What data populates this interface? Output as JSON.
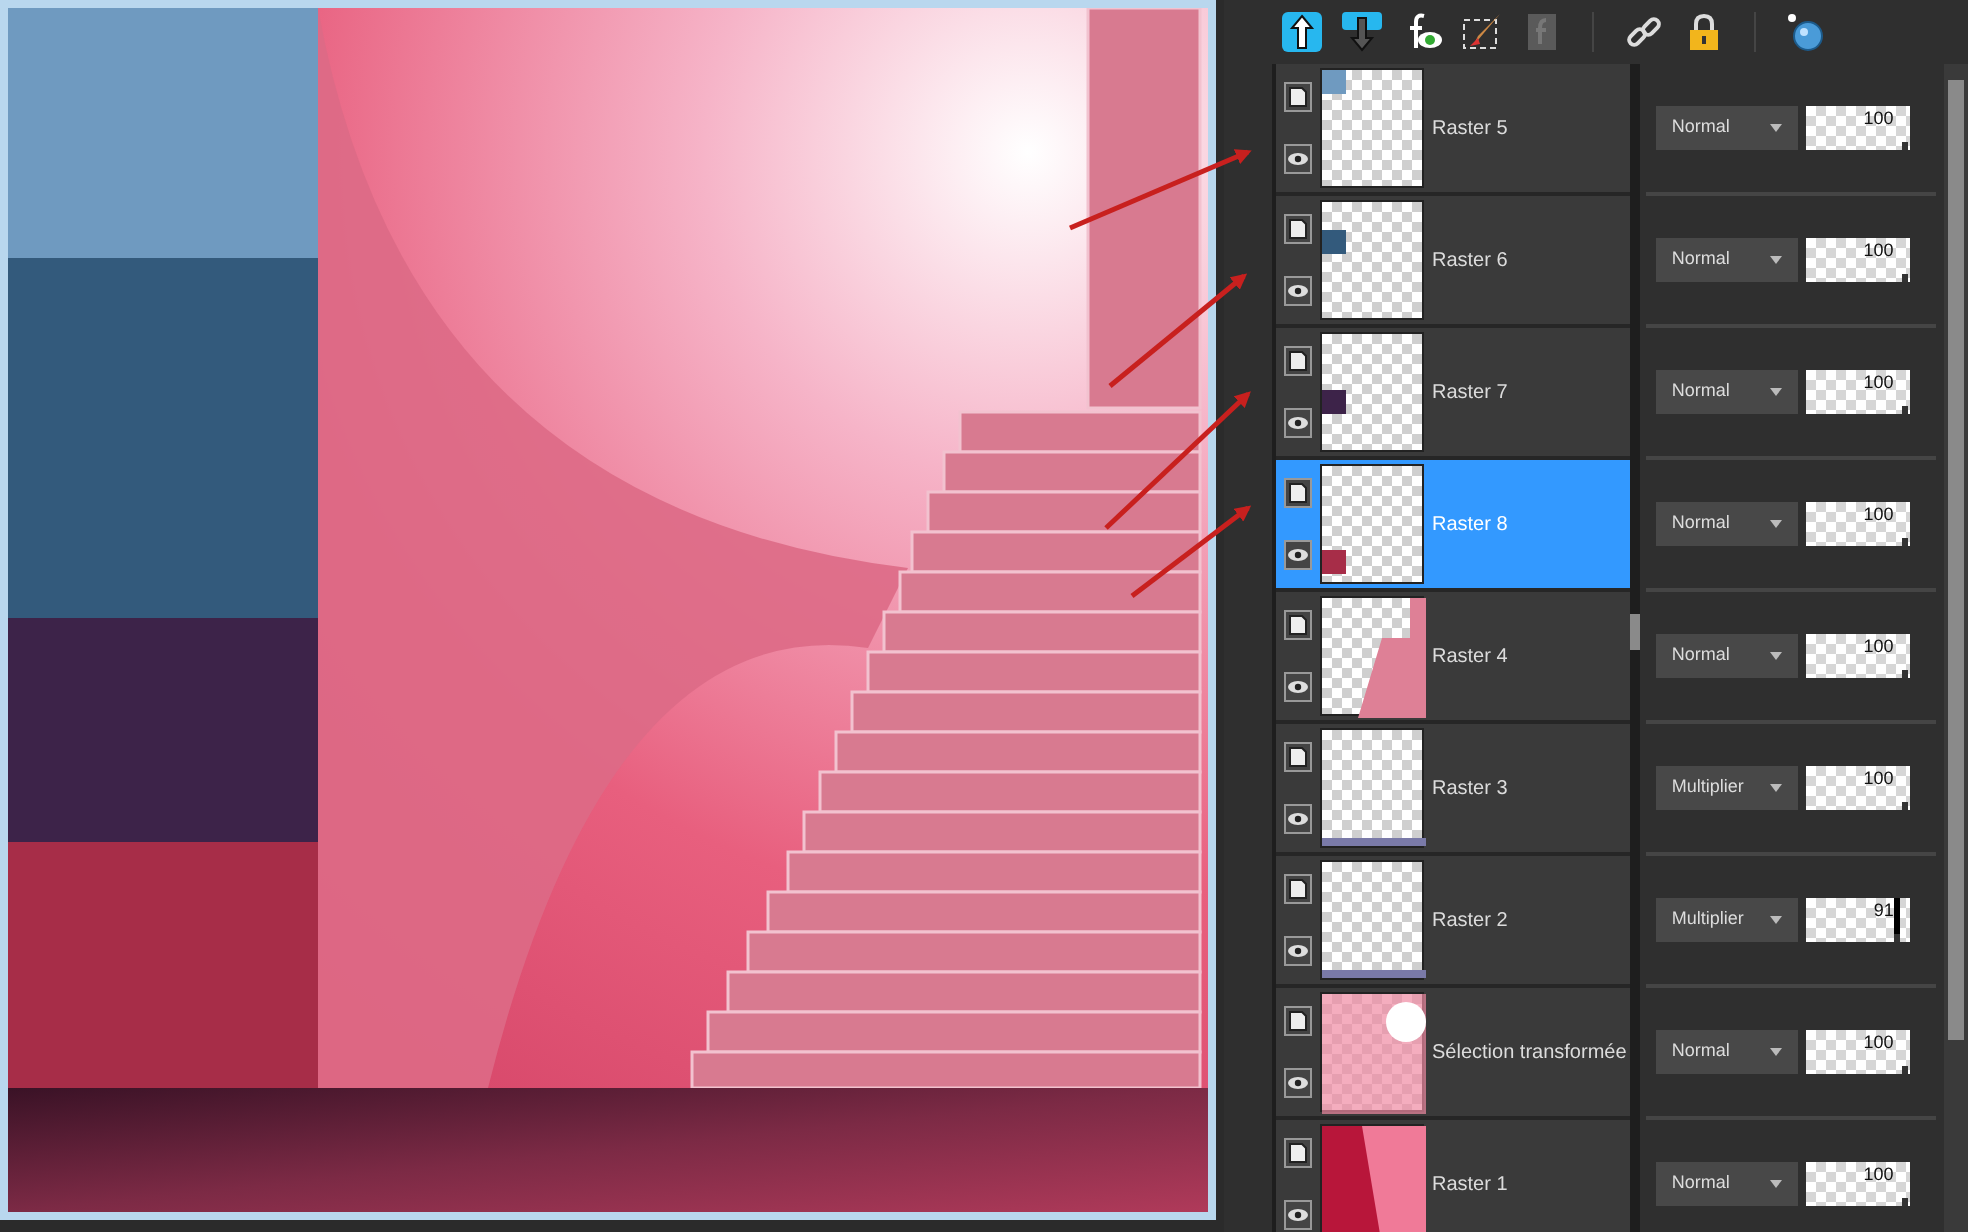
{
  "layers": [
    {
      "name": "Raster 5",
      "selected": false,
      "visible": true,
      "kind": "swatch",
      "color": "#6f9ac0",
      "blend": "Normal",
      "opacity": "100",
      "level": 1
    },
    {
      "name": "Raster 6",
      "selected": false,
      "visible": true,
      "kind": "swatch",
      "color": "#335a7c",
      "blend": "Normal",
      "opacity": "100",
      "level": 1
    },
    {
      "name": "Raster 7",
      "selected": false,
      "visible": true,
      "kind": "swatch",
      "color": "#3d2349",
      "blend": "Normal",
      "opacity": "100",
      "level": 1
    },
    {
      "name": "Raster 8",
      "selected": true,
      "visible": true,
      "kind": "swatch",
      "color": "#a72d48",
      "blend": "Normal",
      "opacity": "100",
      "level": 1
    },
    {
      "name": "Raster 4",
      "selected": false,
      "visible": true,
      "kind": "stairs",
      "blend": "Normal",
      "opacity": "100",
      "level": 1
    },
    {
      "name": "Raster 3",
      "selected": false,
      "visible": true,
      "kind": "strip",
      "blend": "Multiplier",
      "opacity": "100",
      "level": 1
    },
    {
      "name": "Raster 2",
      "selected": false,
      "visible": true,
      "kind": "strip",
      "blend": "Multiplier",
      "opacity": "91",
      "level": 0.91
    },
    {
      "name": "Sélection transformée",
      "selected": false,
      "visible": true,
      "kind": "gradient",
      "blend": "Normal",
      "opacity": "100",
      "level": 1
    },
    {
      "name": "Raster 1",
      "selected": false,
      "visible": true,
      "kind": "noise",
      "blend": "Normal",
      "opacity": "100",
      "level": 1
    }
  ]
}
